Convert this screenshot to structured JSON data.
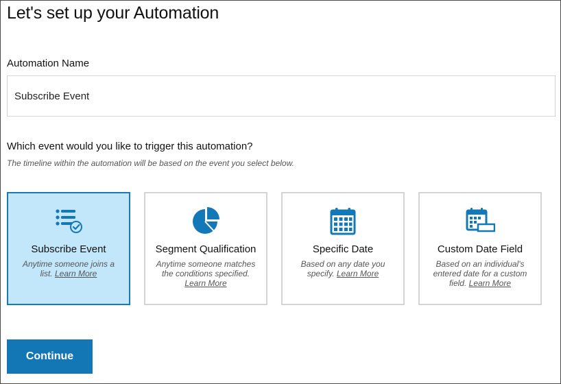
{
  "header": {
    "title": "Let's set up your Automation"
  },
  "name_field": {
    "label": "Automation Name",
    "value": "Subscribe Event"
  },
  "trigger": {
    "question": "Which event would you like to trigger this automation?",
    "hint": "The timeline within the automation will be based on the event you select below.",
    "options": [
      {
        "title": "Subscribe Event",
        "desc": "Anytime someone joins a list.",
        "learn": "Learn More",
        "icon": "list-check-icon",
        "selected": true
      },
      {
        "title": "Segment Qualification",
        "desc": "Anytime someone matches the conditions specified.",
        "learn": "Learn More",
        "icon": "pie-chart-icon",
        "selected": false
      },
      {
        "title": "Specific Date",
        "desc": "Based on any date you specify.",
        "learn": "Learn More",
        "icon": "calendar-icon",
        "selected": false
      },
      {
        "title": "Custom Date Field",
        "desc": "Based on an individual's entered date for a custom field.",
        "learn": "Learn More",
        "icon": "calendar-field-icon",
        "selected": false
      }
    ]
  },
  "continue_label": "Continue",
  "colors": {
    "accent": "#1377b5",
    "selected_bg": "#c2e6fa",
    "selected_border": "#1a78b4",
    "icon": "#1278b8"
  }
}
